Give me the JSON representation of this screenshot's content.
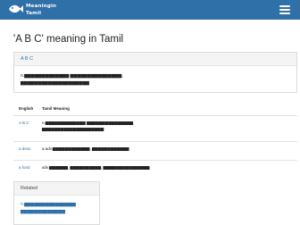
{
  "header": {
    "logo_line1": "Meaningin",
    "logo_line2": "Tamil",
    "brand_color": "#2f70a8"
  },
  "page": {
    "title": "'A B C' meaning in Tamil"
  },
  "word_card": {
    "word": "A B C",
    "meaning_line1": "n.▆▆▆▆▆▆▆▆▆▆▆▆▆ ▆▆▆▆▆▆▆▆▆▆▆▆▆▆▆,",
    "meaning_line2": "▆▆▆▆▆▆▆▆▆▆▆▆▆▆▆▆▆▆▆▆"
  },
  "table": {
    "headers": [
      "English",
      "Tamil Meaning"
    ],
    "rows": [
      {
        "english": "A B C",
        "tamil_line1": "n.▆▆▆▆▆▆▆▆▆▆▆▆▆ ▆▆▆▆▆▆▆▆▆▆▆▆▆▆▆,",
        "tamil_line2": "▆▆▆▆▆▆▆▆▆▆▆▆▆▆▆▆▆▆▆▆"
      },
      {
        "english": "a deux",
        "tamil_line1": "a.adv.▆▆▆▆▆▆▆▆▆▆▆▆, ▆▆▆▆▆▆▆▆▆▆▆▆",
        "tamil_line2": ""
      },
      {
        "english": "a fond",
        "tamil_line1": "adv.▆▆▆▆▆▆, ▆▆▆▆▆▆▆▆▆▆, ▆▆▆▆▆▆▆▆▆▆▆▆▆▆▆",
        "tamil_line2": ""
      }
    ]
  },
  "related": {
    "heading": "Related",
    "line1": "n.▆▆▆▆▆▆▆▆▆▆▆▆▆▆▆",
    "line2": "▆▆▆▆▆▆▆▆▆▆▆▆▆"
  }
}
